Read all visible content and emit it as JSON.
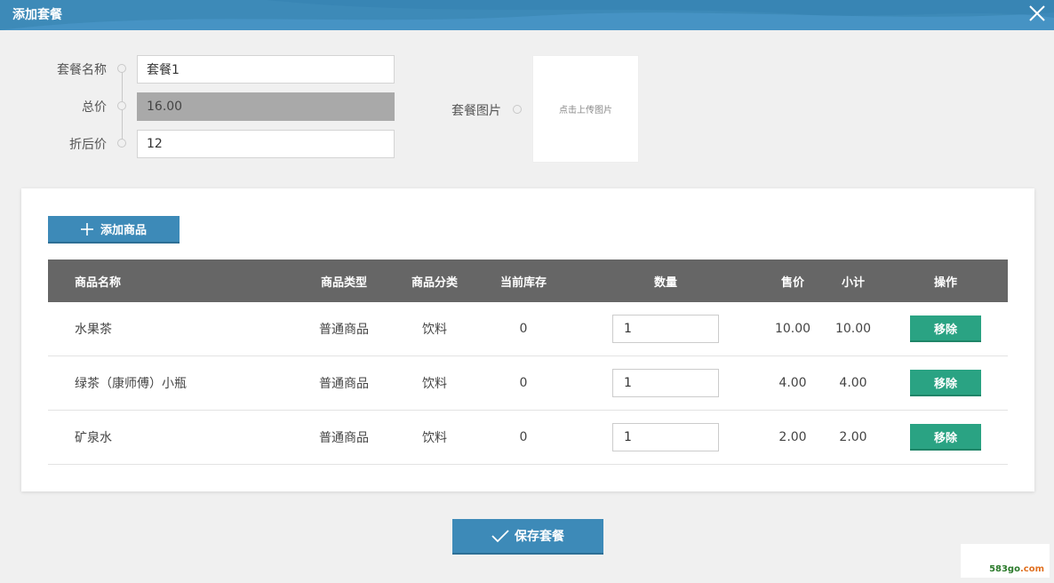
{
  "dialog": {
    "title": "添加套餐"
  },
  "form": {
    "name_label": "套餐名称",
    "name_value": "套餐1",
    "total_label": "总价",
    "total_value": "16.00",
    "discount_label": "折后价",
    "discount_value": "12",
    "image_label": "套餐图片",
    "image_upload_text": "点击上传图片"
  },
  "toolbar": {
    "add_label": "添加商品"
  },
  "table": {
    "headers": {
      "name": "商品名称",
      "type": "商品类型",
      "category": "商品分类",
      "stock": "当前库存",
      "quantity": "数量",
      "price": "售价",
      "subtotal": "小计",
      "action": "操作"
    },
    "rows": [
      {
        "name": "水果茶",
        "type": "普通商品",
        "category": "饮料",
        "stock": "0",
        "quantity": "1",
        "price": "10.00",
        "subtotal": "10.00",
        "action": "移除"
      },
      {
        "name": "绿茶（康师傅）小瓶",
        "type": "普通商品",
        "category": "饮料",
        "stock": "0",
        "quantity": "1",
        "price": "4.00",
        "subtotal": "4.00",
        "action": "移除"
      },
      {
        "name": "矿泉水",
        "type": "普通商品",
        "category": "饮料",
        "stock": "0",
        "quantity": "1",
        "price": "2.00",
        "subtotal": "2.00",
        "action": "移除"
      }
    ]
  },
  "footer": {
    "save_label": "保存套餐"
  },
  "watermark": {
    "text": "583go",
    "suffix": ".com"
  },
  "colors": {
    "primary": "#3d8ab8",
    "success": "#2aa383",
    "header_bg": "#666666",
    "disabled_bg": "#a9a9a9"
  }
}
